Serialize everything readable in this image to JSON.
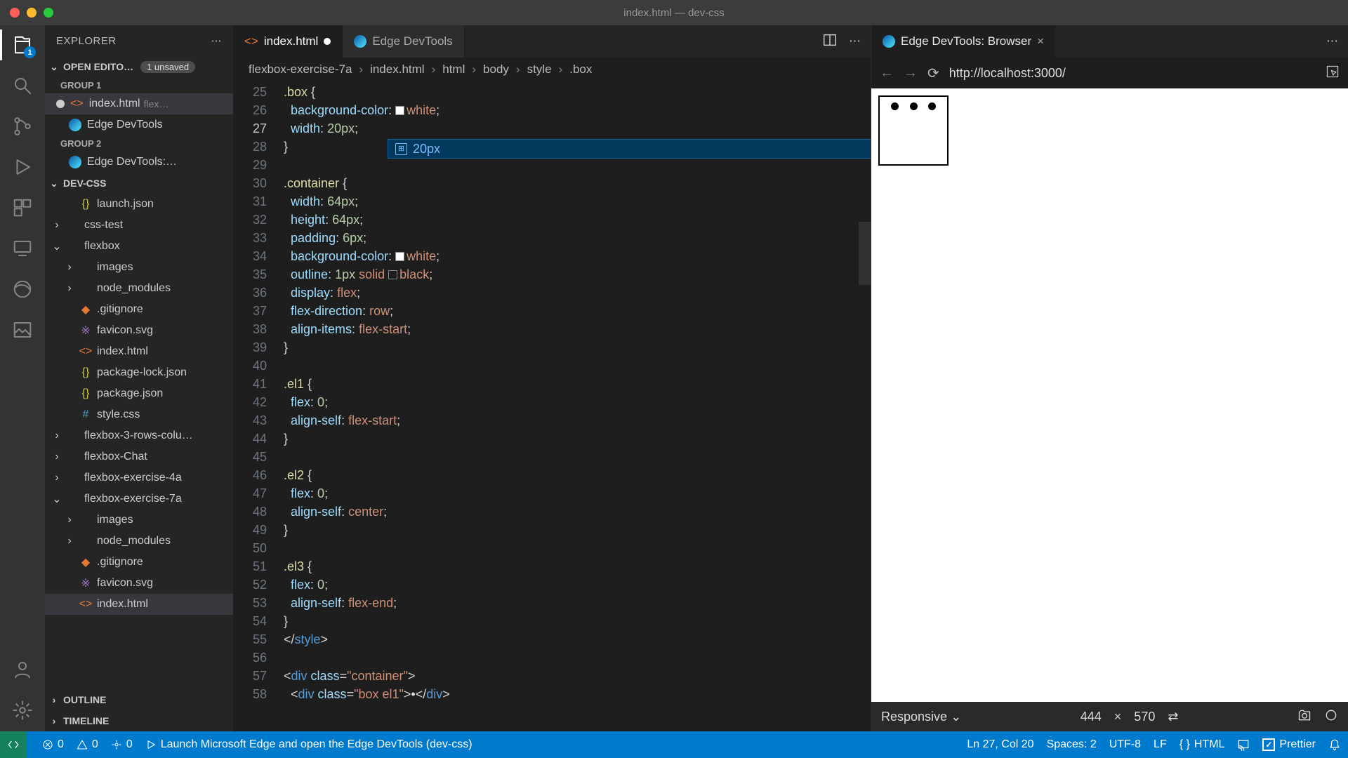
{
  "window": {
    "title": "index.html — dev-css"
  },
  "activity": {
    "files_badge": "1"
  },
  "sidebar": {
    "title": "EXPLORER",
    "open_editors": {
      "label": "OPEN EDITO…",
      "unsaved": "1 unsaved"
    },
    "group1": "GROUP 1",
    "group2": "GROUP 2",
    "editors": {
      "index": {
        "name": "index.html",
        "path": "flex…"
      },
      "devtools": {
        "name": "Edge DevTools"
      },
      "browser": {
        "name": "Edge DevTools:…"
      }
    },
    "project": "DEV-CSS",
    "tree": [
      {
        "name": "launch.json",
        "depth": 1,
        "icon": "json"
      },
      {
        "name": "css-test",
        "depth": 0,
        "icon": "folder",
        "chev": "›"
      },
      {
        "name": "flexbox",
        "depth": 0,
        "icon": "folder",
        "chev": "⌄"
      },
      {
        "name": "images",
        "depth": 1,
        "icon": "folder",
        "chev": "›"
      },
      {
        "name": "node_modules",
        "depth": 1,
        "icon": "folder",
        "chev": "›"
      },
      {
        "name": ".gitignore",
        "depth": 1,
        "icon": "git"
      },
      {
        "name": "favicon.svg",
        "depth": 1,
        "icon": "svg"
      },
      {
        "name": "index.html",
        "depth": 1,
        "icon": "html"
      },
      {
        "name": "package-lock.json",
        "depth": 1,
        "icon": "json"
      },
      {
        "name": "package.json",
        "depth": 1,
        "icon": "json"
      },
      {
        "name": "style.css",
        "depth": 1,
        "icon": "css"
      },
      {
        "name": "flexbox-3-rows-colu…",
        "depth": 0,
        "icon": "folder",
        "chev": "›"
      },
      {
        "name": "flexbox-Chat",
        "depth": 0,
        "icon": "folder",
        "chev": "›"
      },
      {
        "name": "flexbox-exercise-4a",
        "depth": 0,
        "icon": "folder",
        "chev": "›"
      },
      {
        "name": "flexbox-exercise-7a",
        "depth": 0,
        "icon": "folder",
        "chev": "⌄"
      },
      {
        "name": "images",
        "depth": 1,
        "icon": "folder",
        "chev": "›"
      },
      {
        "name": "node_modules",
        "depth": 1,
        "icon": "folder",
        "chev": "›"
      },
      {
        "name": ".gitignore",
        "depth": 1,
        "icon": "git"
      },
      {
        "name": "favicon.svg",
        "depth": 1,
        "icon": "svg"
      },
      {
        "name": "index.html",
        "depth": 1,
        "icon": "html",
        "sel": true
      }
    ],
    "outline": "OUTLINE",
    "timeline": "TIMELINE"
  },
  "tabs": {
    "index": "index.html",
    "devtools": "Edge DevTools",
    "browser": "Edge DevTools: Browser"
  },
  "crumbs": [
    "flexbox-exercise-7a",
    "index.html",
    "html",
    "body",
    "style",
    ".box"
  ],
  "code": {
    "start": 25,
    "current": 27,
    "lines": [
      [
        [
          "y",
          ".box"
        ],
        [
          "w",
          " {"
        ]
      ],
      [
        [
          "w",
          "  "
        ],
        [
          "b",
          "background-color"
        ],
        [
          "w",
          ": "
        ],
        [
          "sq-white",
          ""
        ],
        [
          "o",
          "white"
        ],
        [
          "w",
          ";"
        ]
      ],
      [
        [
          "w",
          "  "
        ],
        [
          "b",
          "width"
        ],
        [
          "w",
          ": "
        ],
        [
          "g",
          "20px"
        ],
        [
          "w",
          ";"
        ]
      ],
      [
        [
          "w",
          "}"
        ]
      ],
      [],
      [
        [
          "y",
          ".container"
        ],
        [
          "w",
          " {"
        ]
      ],
      [
        [
          "w",
          "  "
        ],
        [
          "b",
          "width"
        ],
        [
          "w",
          ": "
        ],
        [
          "g",
          "64px"
        ],
        [
          "w",
          ";"
        ]
      ],
      [
        [
          "w",
          "  "
        ],
        [
          "b",
          "height"
        ],
        [
          "w",
          ": "
        ],
        [
          "g",
          "64px"
        ],
        [
          "w",
          ";"
        ]
      ],
      [
        [
          "w",
          "  "
        ],
        [
          "b",
          "padding"
        ],
        [
          "w",
          ": "
        ],
        [
          "g",
          "6px"
        ],
        [
          "w",
          ";"
        ]
      ],
      [
        [
          "w",
          "  "
        ],
        [
          "b",
          "background-color"
        ],
        [
          "w",
          ": "
        ],
        [
          "sq-white",
          ""
        ],
        [
          "o",
          "white"
        ],
        [
          "w",
          ";"
        ]
      ],
      [
        [
          "w",
          "  "
        ],
        [
          "b",
          "outline"
        ],
        [
          "w",
          ": "
        ],
        [
          "g",
          "1px"
        ],
        [
          "w",
          " "
        ],
        [
          "o",
          "solid"
        ],
        [
          "w",
          " "
        ],
        [
          "sq",
          ""
        ],
        [
          "o",
          "black"
        ],
        [
          "w",
          ";"
        ]
      ],
      [
        [
          "w",
          "  "
        ],
        [
          "b",
          "display"
        ],
        [
          "w",
          ": "
        ],
        [
          "o",
          "flex"
        ],
        [
          "w",
          ";"
        ]
      ],
      [
        [
          "w",
          "  "
        ],
        [
          "b",
          "flex-direction"
        ],
        [
          "w",
          ": "
        ],
        [
          "o",
          "row"
        ],
        [
          "w",
          ";"
        ]
      ],
      [
        [
          "w",
          "  "
        ],
        [
          "b",
          "align-items"
        ],
        [
          "w",
          ": "
        ],
        [
          "o",
          "flex-start"
        ],
        [
          "w",
          ";"
        ]
      ],
      [
        [
          "w",
          "}"
        ]
      ],
      [],
      [
        [
          "y",
          ".el1"
        ],
        [
          "w",
          " {"
        ]
      ],
      [
        [
          "w",
          "  "
        ],
        [
          "b",
          "flex"
        ],
        [
          "w",
          ": "
        ],
        [
          "g",
          "0"
        ],
        [
          "w",
          ";"
        ]
      ],
      [
        [
          "w",
          "  "
        ],
        [
          "b",
          "align-self"
        ],
        [
          "w",
          ": "
        ],
        [
          "o",
          "flex-start"
        ],
        [
          "w",
          ";"
        ]
      ],
      [
        [
          "w",
          "}"
        ]
      ],
      [],
      [
        [
          "y",
          ".el2"
        ],
        [
          "w",
          " {"
        ]
      ],
      [
        [
          "w",
          "  "
        ],
        [
          "b",
          "flex"
        ],
        [
          "w",
          ": "
        ],
        [
          "g",
          "0"
        ],
        [
          "w",
          ";"
        ]
      ],
      [
        [
          "w",
          "  "
        ],
        [
          "b",
          "align-self"
        ],
        [
          "w",
          ": "
        ],
        [
          "o",
          "center"
        ],
        [
          "w",
          ";"
        ]
      ],
      [
        [
          "w",
          "}"
        ]
      ],
      [],
      [
        [
          "y",
          ".el3"
        ],
        [
          "w",
          " {"
        ]
      ],
      [
        [
          "w",
          "  "
        ],
        [
          "b",
          "flex"
        ],
        [
          "w",
          ": "
        ],
        [
          "g",
          "0"
        ],
        [
          "w",
          ";"
        ]
      ],
      [
        [
          "w",
          "  "
        ],
        [
          "b",
          "align-self"
        ],
        [
          "w",
          ": "
        ],
        [
          "o",
          "flex-end"
        ],
        [
          "w",
          ";"
        ]
      ],
      [
        [
          "w",
          "}"
        ]
      ],
      [
        [
          "w",
          "</"
        ],
        [
          "p",
          "style"
        ],
        [
          "w",
          ">"
        ]
      ],
      [],
      [
        [
          "w",
          "<"
        ],
        [
          "p",
          "div"
        ],
        [
          "w",
          " "
        ],
        [
          "b",
          "class"
        ],
        [
          "w",
          "="
        ],
        [
          "o",
          "\"container\""
        ],
        [
          "w",
          ">"
        ]
      ],
      [
        [
          "w",
          "  <"
        ],
        [
          "p",
          "div"
        ],
        [
          "w",
          " "
        ],
        [
          "b",
          "class"
        ],
        [
          "w",
          "="
        ],
        [
          "o",
          "\"box el1\""
        ],
        [
          "w",
          ">•</"
        ],
        [
          "p",
          "div"
        ],
        [
          "w",
          ">"
        ]
      ]
    ],
    "suggest": "20px"
  },
  "preview": {
    "url": "http://localhost:3000/",
    "responsive": "Responsive",
    "w": "444",
    "h": "570"
  },
  "status": {
    "errors": "0",
    "warnings": "0",
    "ports": "0",
    "launch": "Launch Microsoft Edge and open the Edge DevTools (dev-css)",
    "pos": "Ln 27, Col 20",
    "spaces": "Spaces: 2",
    "enc": "UTF-8",
    "eol": "LF",
    "lang": "HTML",
    "prettier": "Prettier"
  }
}
